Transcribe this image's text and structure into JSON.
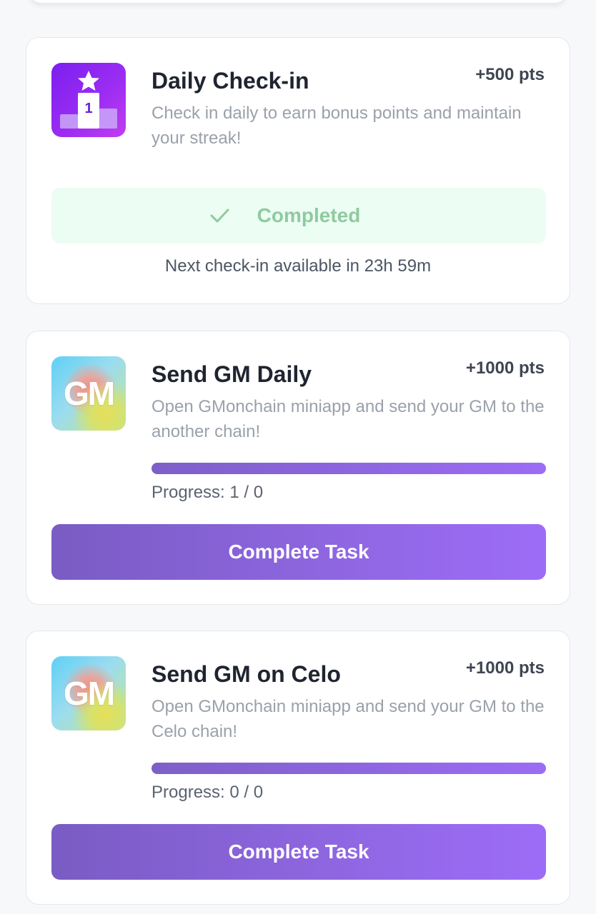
{
  "checkin": {
    "title": "Daily Check-in",
    "points": "+500 pts",
    "description": "Check in daily to earn bonus points and maintain your streak!",
    "icon": "podium-star-icon",
    "icon_badge": "1",
    "status_label": "Completed",
    "next_checkin": "Next check-in available in 23h 59m"
  },
  "tasks": [
    {
      "title": "Send GM Daily",
      "points": "+1000 pts",
      "description": "Open GMonchain miniapp and send your GM to the another chain!",
      "icon_text": "GM",
      "progress_text": "Progress: 1 / 0",
      "progress_fraction": 1.0,
      "button_label": "Complete Task"
    },
    {
      "title": "Send GM on Celo",
      "points": "+1000 pts",
      "description": "Open GMonchain miniapp and send your GM to the Celo chain!",
      "icon_text": "GM",
      "progress_text": "Progress: 0 / 0",
      "progress_fraction": 1.0,
      "button_label": "Complete Task"
    }
  ],
  "colors": {
    "accent_purple": "#9c6cf5",
    "completed_green": "#8fcaa0",
    "completed_bg": "#ecfdf3"
  }
}
